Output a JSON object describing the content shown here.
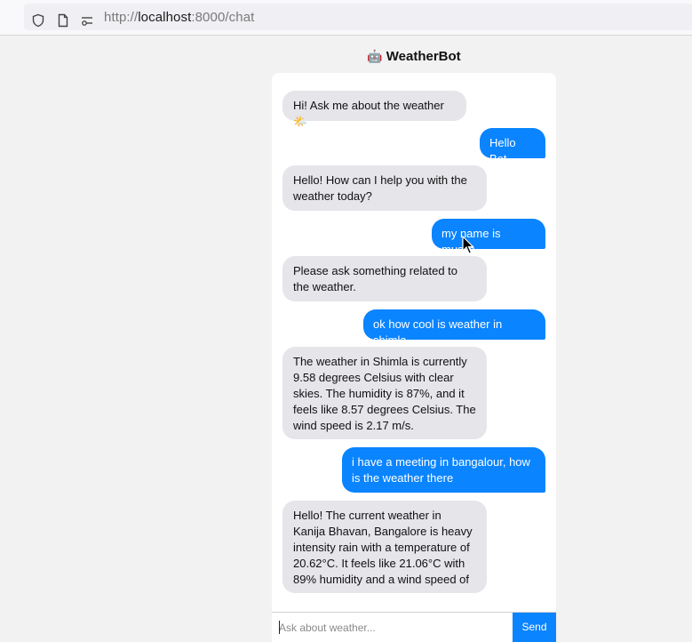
{
  "browser": {
    "url_prefix": "http://",
    "url_host": "localhost",
    "url_rest": ":8000/chat"
  },
  "app": {
    "title": "WeatherBot",
    "title_emoji": "🤖"
  },
  "messages": [
    {
      "role": "bot",
      "text": "Hi! Ask me about the weather 🌤️"
    },
    {
      "role": "user",
      "text": "Hello Bot"
    },
    {
      "role": "bot",
      "text": "Hello! How can I help you with the weather today?"
    },
    {
      "role": "user",
      "text": "my name is muslih"
    },
    {
      "role": "bot",
      "text": "Please ask something related to the weather."
    },
    {
      "role": "user",
      "text": "ok how cool is weather in shimla"
    },
    {
      "role": "bot",
      "text": "The weather in Shimla is currently 9.58 degrees Celsius with clear skies. The humidity is 87%, and it feels like 8.57 degrees Celsius. The wind speed is 2.17 m/s."
    },
    {
      "role": "user",
      "text": "i have a meeting in bangalour, how is the weather there"
    },
    {
      "role": "bot",
      "text": "Hello! The current weather in Kanija Bhavan, Bangalore is heavy intensity rain with a temperature of 20.62°C. It feels like 21.06°C with 89% humidity and a wind speed of"
    }
  ],
  "input": {
    "placeholder": "Ask about weather...",
    "value": ""
  },
  "send_label": "Send",
  "colors": {
    "user_bubble": "#0a84ff",
    "bot_bubble": "#e5e5ea",
    "send_button": "#0a84ff"
  }
}
